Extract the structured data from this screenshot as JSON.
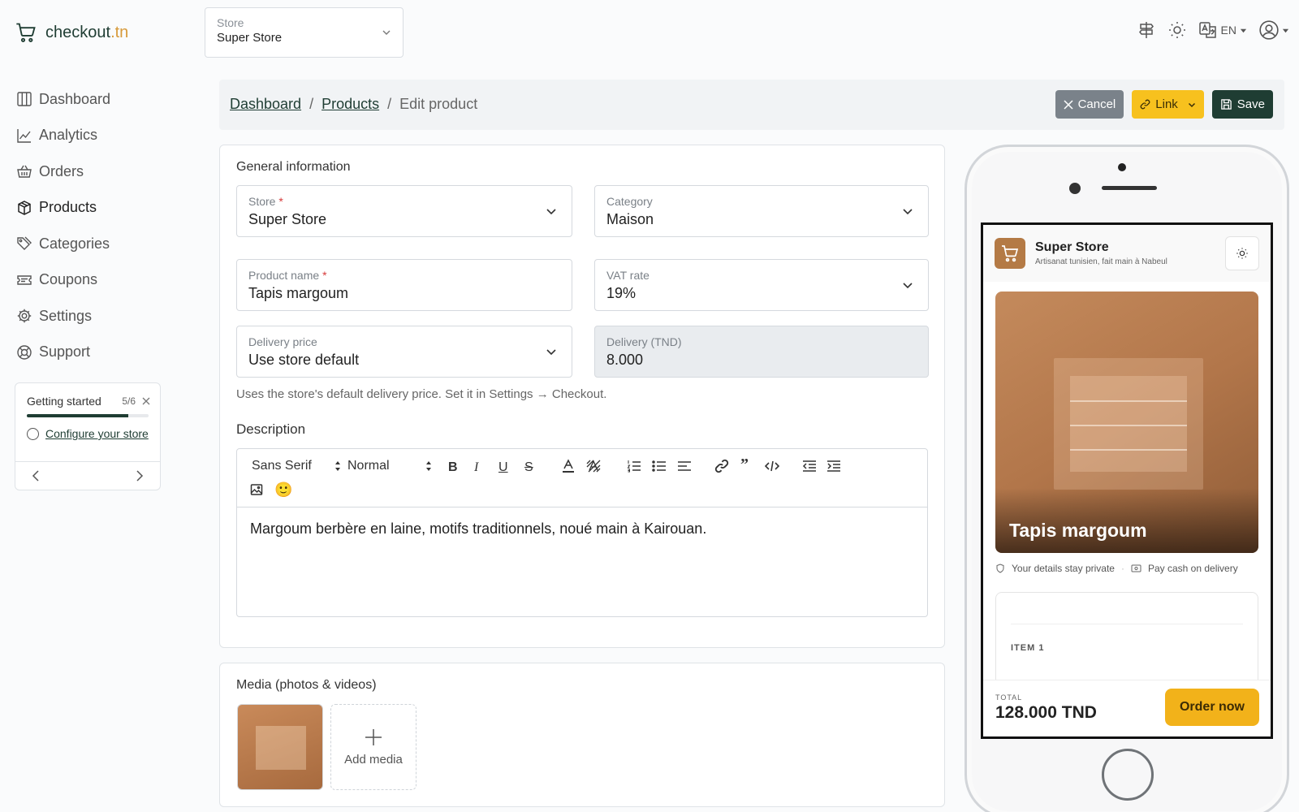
{
  "brand": {
    "name": "checkout",
    "tld": ".tn"
  },
  "store_switch": {
    "label": "Store",
    "value": "Super Store"
  },
  "header": {
    "lang": "EN"
  },
  "sidebar": {
    "items": [
      {
        "label": "Dashboard",
        "icon": "columns-icon"
      },
      {
        "label": "Analytics",
        "icon": "chart-line-icon"
      },
      {
        "label": "Orders",
        "icon": "basket-icon"
      },
      {
        "label": "Products",
        "icon": "box-icon",
        "active": true
      },
      {
        "label": "Categories",
        "icon": "tags-icon"
      },
      {
        "label": "Coupons",
        "icon": "ticket-icon"
      },
      {
        "label": "Settings",
        "icon": "gear-icon"
      },
      {
        "label": "Support",
        "icon": "lifebuoy-icon"
      }
    ]
  },
  "getting_started": {
    "title": "Getting started",
    "count": "5/6",
    "progress": 0.83,
    "task": "Configure your store"
  },
  "breadcrumb": {
    "items": [
      "Dashboard",
      "Products"
    ],
    "current": "Edit product"
  },
  "actions": {
    "cancel": "Cancel",
    "link": "Link",
    "save": "Save"
  },
  "general": {
    "title": "General information",
    "store": {
      "label": "Store",
      "value": "Super Store"
    },
    "category": {
      "label": "Category",
      "value": "Maison"
    },
    "product_name": {
      "label": "Product name",
      "value": "Tapis margoum"
    },
    "vat": {
      "label": "VAT rate",
      "value": "19%"
    },
    "delivery_price": {
      "label": "Delivery price",
      "value": "Use store default"
    },
    "delivery_tnd": {
      "label": "Delivery (TND)",
      "value": "8.000"
    },
    "hint": "Uses the store's default delivery price. Set it in Settings → Checkout.",
    "description_label": "Description",
    "toolbar": {
      "font": "Sans Serif",
      "size": "Normal"
    },
    "description": "Margoum berbère en laine, motifs traditionnels, noué main à Kairouan."
  },
  "media": {
    "title": "Media (photos & videos)",
    "add_label": "Add media"
  },
  "preview": {
    "shop_name": "Super Store",
    "shop_tagline": "Artisanat tunisien, fait main à Nabeul",
    "product_title": "Tapis margoum",
    "trust_1": "Your details stay private",
    "trust_2": "Pay cash on delivery",
    "item_label": "ITEM 1",
    "total_label": "TOTAL",
    "total_value": "128.000 TND",
    "order_button": "Order now"
  },
  "colors": {
    "brand": "#1f3d33",
    "accent": "#d79a3a",
    "link_button": "#f7c11e",
    "cancel_button": "#7a828a",
    "order_button": "#f2b21a"
  }
}
